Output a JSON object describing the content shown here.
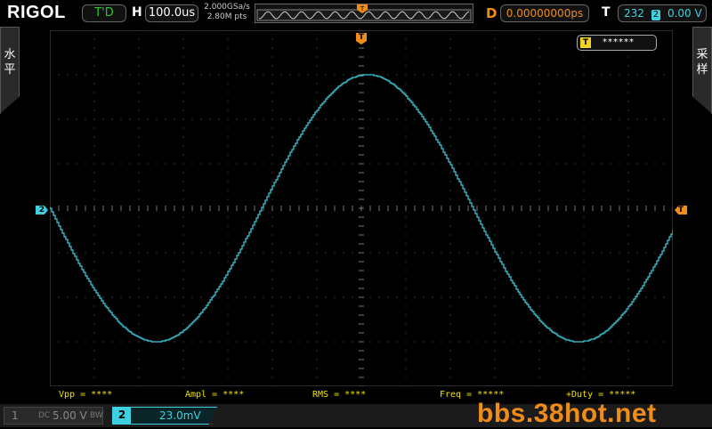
{
  "header": {
    "brand": "RIGOL",
    "run_status": "T'D",
    "horizontal_label": "H",
    "timebase": "100.0us",
    "sample_rate": "2.000GSa/s",
    "memory_depth": "2.80M pts",
    "trigger_position_label": "T",
    "delay_label": "D",
    "delay_value": "0.00000000ps",
    "trigger_label": "T",
    "trigger_counter": "232",
    "trigger_source": "2",
    "trigger_level": "0.00 V"
  },
  "side_tabs": {
    "left": "水平",
    "right": "采样"
  },
  "screen": {
    "channel_marker": "2",
    "trigger_level_marker": "T",
    "trigger_status_icon": "T",
    "trigger_status_text": "******",
    "trace_color": "#3cd0e0",
    "waveform": {
      "type": "sine",
      "period_div": 9.5,
      "amplitude_div": 3.0,
      "phase_deg_at_left": 180
    }
  },
  "measurements": [
    {
      "label": "Vpp = ****"
    },
    {
      "label": "Ampl = ****"
    },
    {
      "label": "RMS = ****"
    },
    {
      "label": "Freq = *****"
    },
    {
      "label": "+Duty = *****"
    }
  ],
  "channels": {
    "ch1": {
      "number": "1",
      "coupling_icon": "DC",
      "scale": "5.00 V",
      "bw_icon": "BW"
    },
    "ch2": {
      "number": "2",
      "scale": "23.0mV"
    }
  },
  "watermark": "bbs.38hot.net",
  "colors": {
    "trigger_accent": "#f08c18",
    "run_status": "#2ec52e",
    "ch2": "#3cd0e0",
    "measure_text": "#f0e000"
  }
}
